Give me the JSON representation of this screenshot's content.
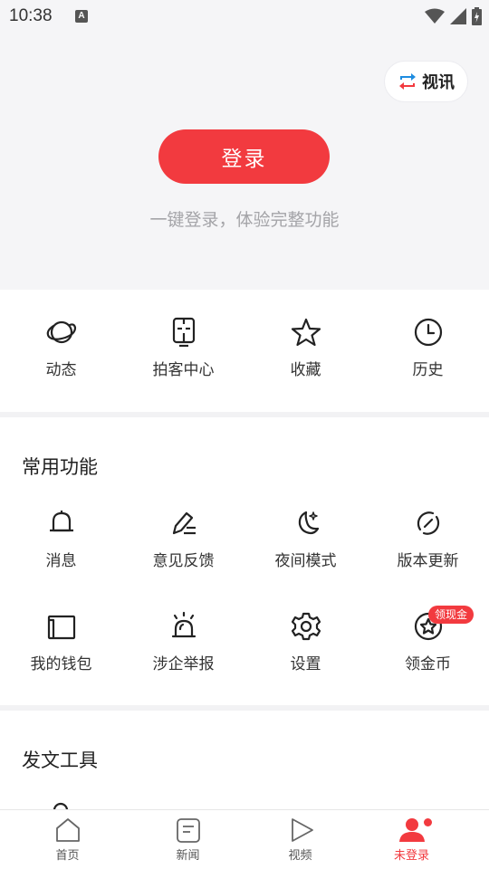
{
  "status_bar": {
    "time": "10:38",
    "notification_letter": "A"
  },
  "header": {
    "shixun_label": "视讯",
    "login_label": "登录",
    "login_hint": "一键登录，体验完整功能"
  },
  "quick_actions": [
    {
      "label": "动态",
      "icon": "planet-icon"
    },
    {
      "label": "拍客中心",
      "icon": "camera-device-icon"
    },
    {
      "label": "收藏",
      "icon": "star-icon"
    },
    {
      "label": "历史",
      "icon": "clock-icon"
    }
  ],
  "common_functions": {
    "title": "常用功能",
    "items": [
      {
        "label": "消息",
        "icon": "bell-icon"
      },
      {
        "label": "意见反馈",
        "icon": "edit-pen-icon"
      },
      {
        "label": "夜间模式",
        "icon": "moon-icon"
      },
      {
        "label": "版本更新",
        "icon": "refresh-icon"
      },
      {
        "label": "我的钱包",
        "icon": "wallet-icon"
      },
      {
        "label": "涉企举报",
        "icon": "alarm-siren-icon"
      },
      {
        "label": "设置",
        "icon": "gear-icon"
      },
      {
        "label": "领金币",
        "icon": "coin-star-icon"
      }
    ],
    "badge": "领现金"
  },
  "publishing_tools": {
    "title": "发文工具"
  },
  "tab_bar": [
    {
      "label": "首页",
      "icon": "home-icon"
    },
    {
      "label": "新闻",
      "icon": "news-icon"
    },
    {
      "label": "视频",
      "icon": "play-icon"
    },
    {
      "label": "未登录",
      "icon": "user-icon",
      "active": true
    }
  ],
  "colors": {
    "accent": "#f23a3f",
    "background": "#f5f5f7"
  }
}
